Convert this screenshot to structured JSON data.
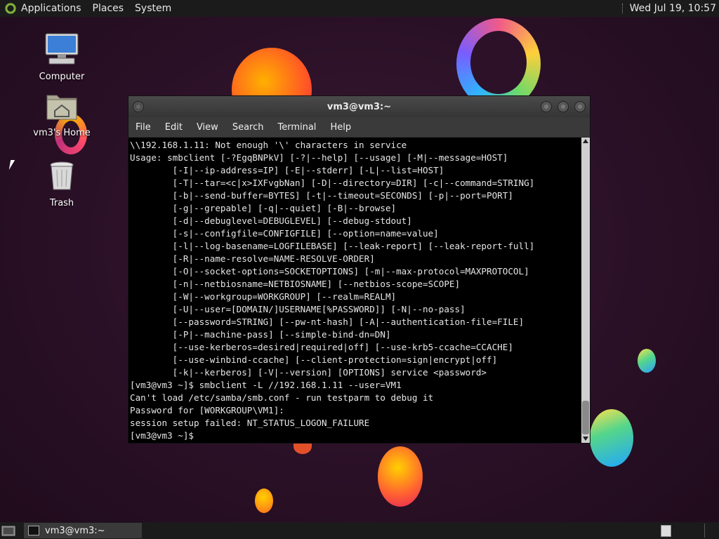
{
  "top_panel": {
    "menus": [
      "Applications",
      "Places",
      "System"
    ],
    "clock": "Wed Jul 19, 10:57"
  },
  "desktop_icons": [
    {
      "label": "Computer",
      "icon": "computer-icon"
    },
    {
      "label": "vm3's Home",
      "icon": "home-folder-icon"
    },
    {
      "label": "Trash",
      "icon": "trash-icon"
    }
  ],
  "terminal": {
    "title": "vm3@vm3:~",
    "menus": [
      "File",
      "Edit",
      "View",
      "Search",
      "Terminal",
      "Help"
    ],
    "output": "\\\\192.168.1.11: Not enough '\\' characters in service\nUsage: smbclient [-?EgqBNPkV] [-?|--help] [--usage] [-M|--message=HOST]\n        [-I|--ip-address=IP] [-E|--stderr] [-L|--list=HOST]\n        [-T|--tar=<c|x>IXFvgbNan] [-D|--directory=DIR] [-c|--command=STRING]\n        [-b|--send-buffer=BYTES] [-t|--timeout=SECONDS] [-p|--port=PORT]\n        [-g|--grepable] [-q|--quiet] [-B|--browse]\n        [-d|--debuglevel=DEBUGLEVEL] [--debug-stdout]\n        [-s|--configfile=CONFIGFILE] [--option=name=value]\n        [-l|--log-basename=LOGFILEBASE] [--leak-report] [--leak-report-full]\n        [-R|--name-resolve=NAME-RESOLVE-ORDER]\n        [-O|--socket-options=SOCKETOPTIONS] [-m|--max-protocol=MAXPROTOCOL]\n        [-n|--netbiosname=NETBIOSNAME] [--netbios-scope=SCOPE]\n        [-W|--workgroup=WORKGROUP] [--realm=REALM]\n        [-U|--user=[DOMAIN/]USERNAME[%PASSWORD]] [-N|--no-pass]\n        [--password=STRING] [--pw-nt-hash] [-A|--authentication-file=FILE]\n        [-P|--machine-pass] [--simple-bind-dn=DN]\n        [--use-kerberos=desired|required|off] [--use-krb5-ccache=CCACHE]\n        [--use-winbind-ccache] [--client-protection=sign|encrypt|off]\n        [-k|--kerberos] [-V|--version] [OPTIONS] service <password>\n[vm3@vm3 ~]$ smbclient -L //192.168.1.11 --user=VM1\nCan't load /etc/samba/smb.conf - run testparm to debug it\nPassword for [WORKGROUP\\VM1]:\nsession setup failed: NT_STATUS_LOGON_FAILURE\n[vm3@vm3 ~]$ "
  },
  "taskbar": {
    "task_label": "vm3@vm3:~"
  }
}
